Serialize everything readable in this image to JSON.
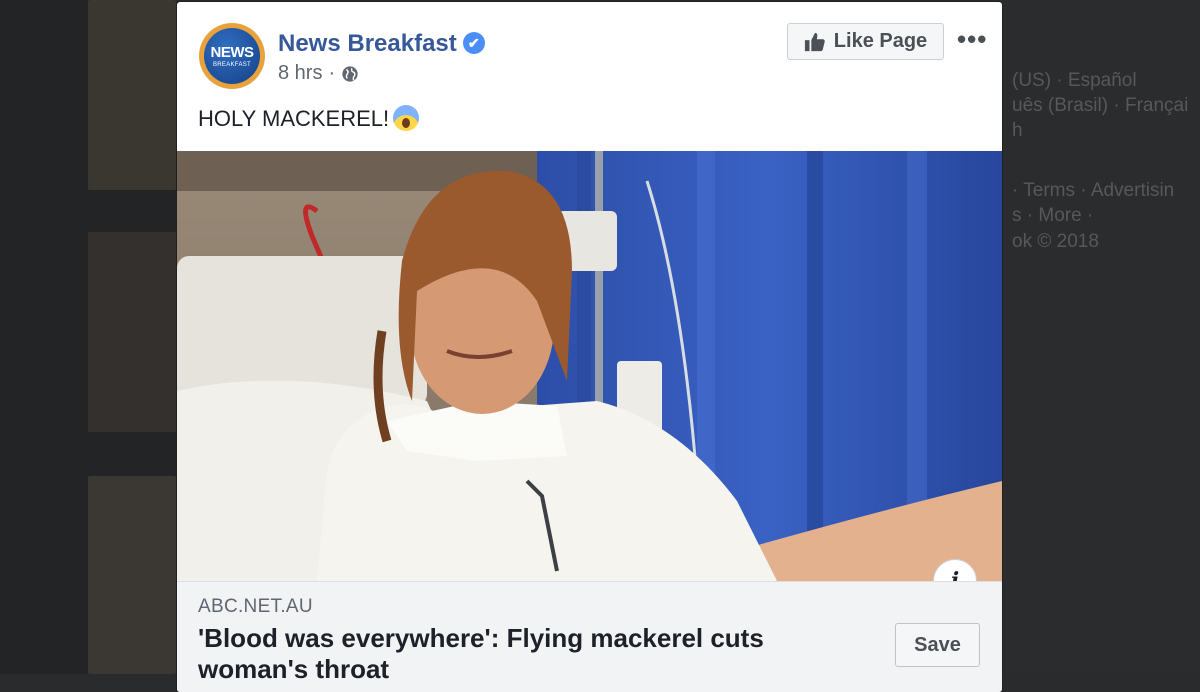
{
  "post": {
    "page_name": "News Breakfast",
    "avatar": {
      "line1": "NEWS",
      "line2": "BREAKFAST"
    },
    "verified_icon": "check-badge-icon",
    "time": "8 hrs",
    "separator": "·",
    "privacy_icon": "globe-icon",
    "like_button": "Like Page",
    "more_label": "•••",
    "text": "HOLY MACKEREL!",
    "emoji": "screaming-face-emoji",
    "image_info_label": "i",
    "link": {
      "domain": "ABC.NET.AU",
      "headline": "'Blood was everywhere': Flying mackerel cuts woman's throat",
      "save_label": "Save"
    }
  },
  "background": {
    "footer_line1": "(US) · Español",
    "footer_line2": "uês (Brasil) · Françai",
    "footer_line3": "h",
    "footer_line4": "· Terms · Advertisin",
    "footer_line5": "s · More ·",
    "footer_line6": "ok © 2018"
  },
  "colors": {
    "brand_blue": "#365899",
    "verified_blue": "#4c8ef7",
    "avatar_ring": "#e8a23b"
  }
}
